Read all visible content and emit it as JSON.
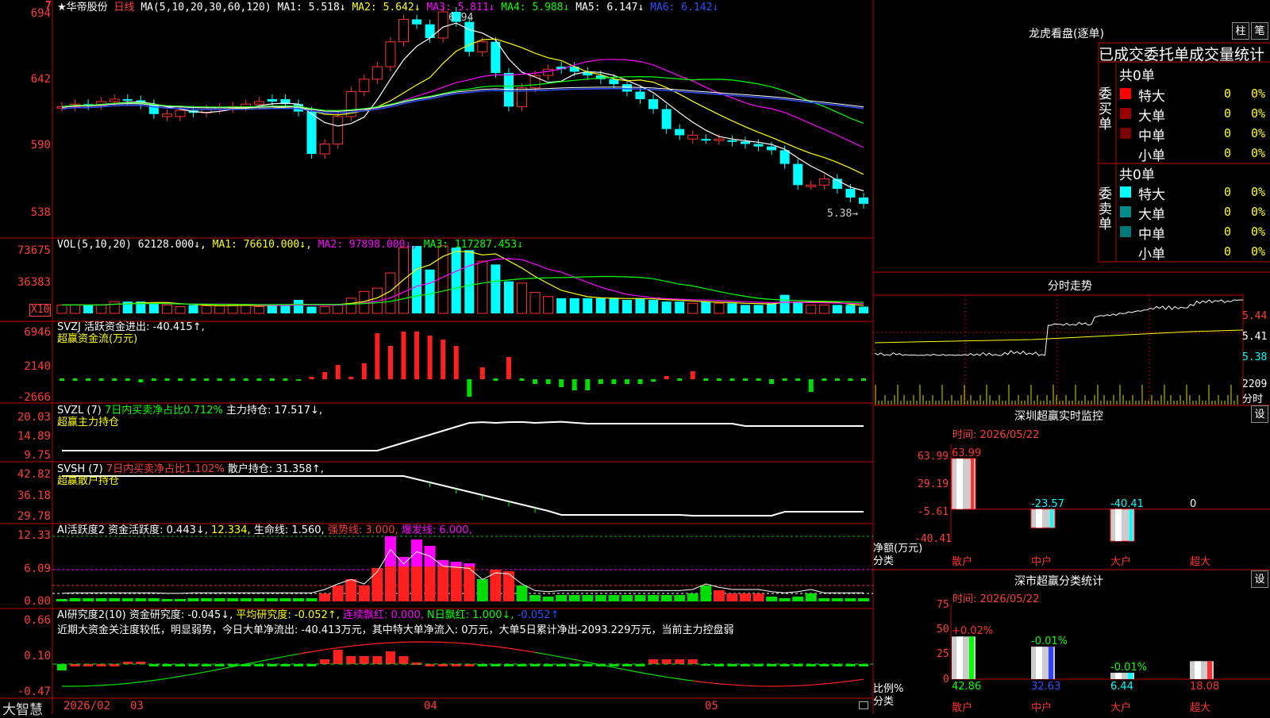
{
  "header": {
    "stock_name": "★华帝股份",
    "period": "日线",
    "ma_def": "MA(5,10,20,30,60,120)",
    "ma1": "MA1: 5.518↓",
    "ma2": "MA2: 5.642↓",
    "ma3": "MA3: 5.811↓",
    "ma4": "MA4: 5.988↓",
    "ma5": "MA5: 6.147↓",
    "ma6": "MA6: 6.142↓",
    "high_mark": "6.94",
    "low_mark": "5.38→",
    "corner_flag": "7"
  },
  "price_axis": [
    "694",
    "642",
    "590",
    "538"
  ],
  "vol": {
    "label": "VOL(5,10,20)",
    "value": "62128.000↓,",
    "ma1": "MA1: 76610.000↓,",
    "ma2": "MA2: 97898.000↓,",
    "ma3": "MA3: 117287.453↓",
    "axis": [
      "73675",
      "36383"
    ],
    "unit": "X10"
  },
  "svzj": {
    "label": "SVZJ  活跃资金进出: -40.415↑,",
    "sub": "超赢资金流(万元)",
    "axis": [
      "6946",
      "2140",
      "-2666"
    ]
  },
  "svzl": {
    "label": "SVZL (7)",
    "t1": "7日内买卖净占比0.712%",
    "t2": "主力持仓: 17.517↓,",
    "sub": "超赢主力持仓",
    "axis": [
      "20.03",
      "14.89",
      "9.75"
    ]
  },
  "svsh": {
    "label": "SVSH (7)",
    "t1": "7日内买卖净占比1.102%",
    "t2": "散户持仓: 31.358↑,",
    "sub": "超赢散户持仓",
    "axis": [
      "42.82",
      "36.18",
      "29.78"
    ]
  },
  "ai": {
    "label": "AI活跃度2",
    "t1": "资金活跃度: 0.443↓,",
    "t2": "12.334,",
    "t3": "生命线: 1.560,",
    "t4": "强势线: 3.000,",
    "t5": "爆发线: 6.000,",
    "axis": [
      "12.33",
      "6.09",
      "0.00"
    ]
  },
  "research": {
    "label": "AI研究度2(10)",
    "t1": "资金研究度: -0.045↓,",
    "t2": "平均研究度: -0.052↑,",
    "t3": "连续飘红: 0.000,",
    "t4": "N日飘红: 1.000↓,",
    "t5": "-0.052↑",
    "comment": "近期大资金关注度较低，明显弱势，今日大单净流出: -40.413万元，其中特大单净流入: 0万元，大单5日累计净出-2093.229万元，当前主力控盘弱",
    "axis": [
      "0.66",
      "0.10",
      "-0.47"
    ]
  },
  "bottom": {
    "brand": "大智慧",
    "dates": [
      "2026/02",
      "03",
      "04",
      "05"
    ]
  },
  "dragon": {
    "title": "龙虎看盘(逐单)",
    "btn1": "柱",
    "btn2": "笔",
    "subtitle": "已成交委托单成交量统计",
    "buy_group": "委买单",
    "sell_group": "委卖单",
    "buy_total": "共0单",
    "sell_total": "共0单",
    "buy_rows": [
      {
        "name": "特大",
        "count": "0",
        "pct": "0%",
        "color": "#ff0000"
      },
      {
        "name": "大单",
        "count": "0",
        "pct": "0%",
        "color": "#990000"
      },
      {
        "name": "中单",
        "count": "0",
        "pct": "0%",
        "color": "#7a0000"
      },
      {
        "name": "小单",
        "count": "0",
        "pct": "0%",
        "color": "#000000"
      }
    ],
    "sell_rows": [
      {
        "name": "特大",
        "count": "0",
        "pct": "0%",
        "color": "#00ffff"
      },
      {
        "name": "大单",
        "count": "0",
        "pct": "0%",
        "color": "#008b8b"
      },
      {
        "name": "中单",
        "count": "0",
        "pct": "0%",
        "color": "#007878"
      },
      {
        "name": "小单",
        "count": "0",
        "pct": "0%",
        "color": "#000000"
      }
    ]
  },
  "intraday": {
    "title": "分时走势",
    "axis": [
      "5.44",
      "5.41",
      "5.38"
    ],
    "vol_label": "2209",
    "vol_unit": "分时"
  },
  "sz_monitor": {
    "title": "深圳超赢实时监控",
    "btn": "设",
    "time": "时间: 2026/05/22",
    "axis": [
      "63.99",
      "29.19",
      "-5.61",
      "-40.41"
    ],
    "unit": "净额(万元)",
    "cat_label": "分类",
    "categories": [
      "散户",
      "中户",
      "大户",
      "超大"
    ],
    "values": [
      63.99,
      -23.57,
      -40.41,
      0
    ],
    "value_labels": [
      "63.99",
      "-23.57",
      "-40.41",
      "0"
    ]
  },
  "sz_class": {
    "title": "深市超赢分类统计",
    "btn": "设",
    "time": "时间: 2026/05/22",
    "axis": [
      "75",
      "50",
      "25",
      "0"
    ],
    "unit": "比例%",
    "cat_label": "分类",
    "categories": [
      "散户",
      "中户",
      "大户",
      "超大"
    ],
    "values": [
      42.86,
      32.63,
      6.44,
      18.08
    ],
    "value_labels": [
      "42.86",
      "32.63",
      "6.44",
      "18.08"
    ],
    "change_labels": [
      "+0.02%",
      "-0.01%",
      "-0.01%",
      ""
    ]
  },
  "chart_data": [
    {
      "type": "bar",
      "title": "深圳超赢实时监控",
      "categories": [
        "散户",
        "中户",
        "大户",
        "超大"
      ],
      "values": [
        63.99,
        -23.57,
        -40.41,
        0
      ],
      "ylabel": "净额(万元)",
      "ylim": [
        -40.41,
        63.99
      ]
    },
    {
      "type": "bar",
      "title": "深市超赢分类统计",
      "categories": [
        "散户",
        "中户",
        "大户",
        "超大"
      ],
      "values": [
        42.86,
        32.63,
        6.44,
        18.08
      ],
      "ylabel": "比例%",
      "ylim": [
        0,
        75
      ]
    }
  ]
}
